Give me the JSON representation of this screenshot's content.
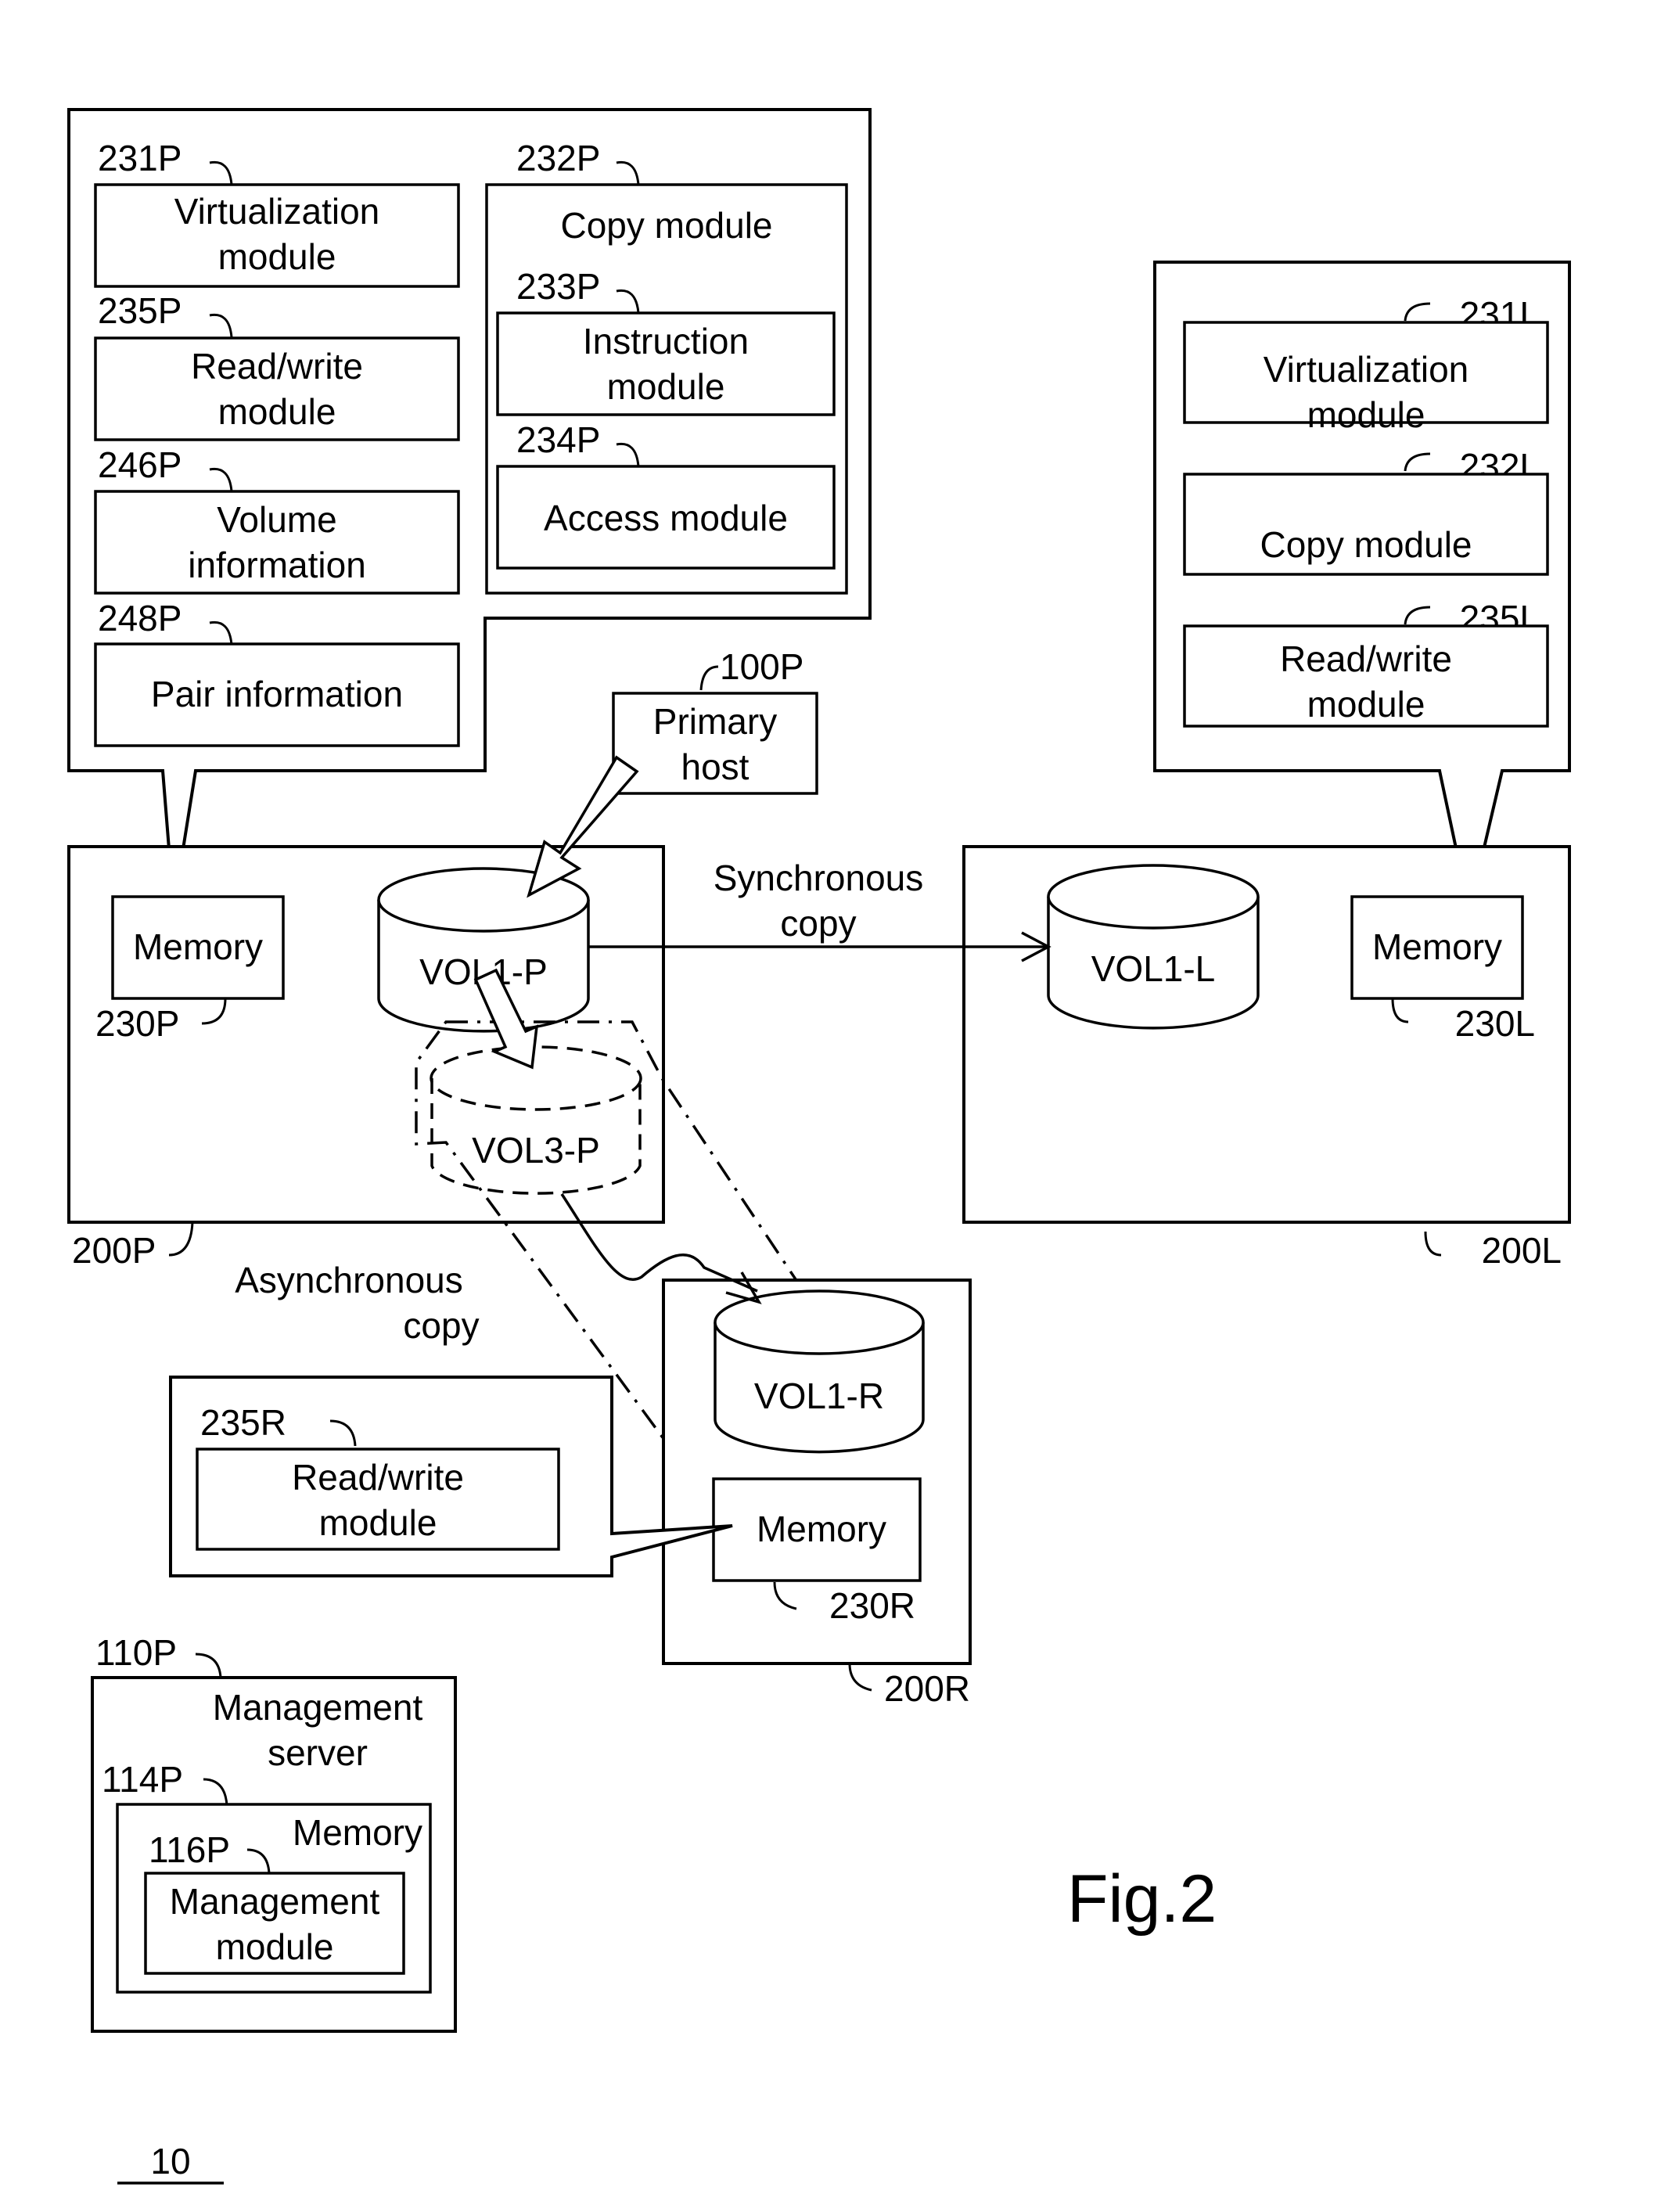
{
  "figure": {
    "title": "Fig.2",
    "system_ref": "10"
  },
  "primary_memory_callout": {
    "modules": [
      {
        "ref": "231P",
        "line1": "Virtualization",
        "line2": "module"
      },
      {
        "ref": "235P",
        "line1": "Read/write",
        "line2": "module"
      },
      {
        "ref": "246P",
        "line1": "Volume",
        "line2": "information"
      },
      {
        "ref": "248P",
        "line1": "Pair information",
        "line2": ""
      }
    ],
    "copy_module": {
      "ref": "232P",
      "label": "Copy module",
      "submodules": [
        {
          "ref": "233P",
          "line1": "Instruction",
          "line2": "module"
        },
        {
          "ref": "234P",
          "line1": "Access module",
          "line2": ""
        }
      ]
    }
  },
  "local_memory_callout": {
    "modules": [
      {
        "ref": "231L",
        "line1": "Virtualization",
        "line2": "module"
      },
      {
        "ref": "232L",
        "line1": "Copy module",
        "line2": ""
      },
      {
        "ref": "235L",
        "line1": "Read/write",
        "line2": "module"
      }
    ]
  },
  "remote_memory_callout": {
    "modules": [
      {
        "ref": "235R",
        "line1": "Read/write",
        "line2": "module"
      }
    ]
  },
  "primary_host": {
    "ref": "100P",
    "line1": "Primary",
    "line2": "host"
  },
  "storage_primary": {
    "ref": "200P",
    "memory": {
      "ref": "230P",
      "label": "Memory"
    },
    "volumes": [
      {
        "name": "VOL1-P",
        "style": "solid"
      },
      {
        "name": "VOL3-P",
        "style": "dashed"
      }
    ]
  },
  "storage_local": {
    "ref": "200L",
    "memory": {
      "ref": "230L",
      "label": "Memory"
    },
    "volumes": [
      {
        "name": "VOL1-L",
        "style": "solid"
      }
    ]
  },
  "storage_remote": {
    "ref": "200R",
    "memory": {
      "ref": "230R",
      "label": "Memory"
    },
    "volumes": [
      {
        "name": "VOL1-R",
        "style": "solid"
      }
    ]
  },
  "connections": {
    "sync": {
      "line1": "Synchronous",
      "line2": "copy",
      "from": "VOL1-P",
      "to": "VOL1-L"
    },
    "async": {
      "line1": "Asynchronous",
      "line2": "copy",
      "from": "VOL3-P",
      "to": "VOL1-R"
    }
  },
  "management_server": {
    "ref": "110P",
    "line1": "Management",
    "line2": "server",
    "memory": {
      "ref": "114P",
      "label": "Memory",
      "module": {
        "ref": "116P",
        "line1": "Management",
        "line2": "module"
      }
    }
  }
}
